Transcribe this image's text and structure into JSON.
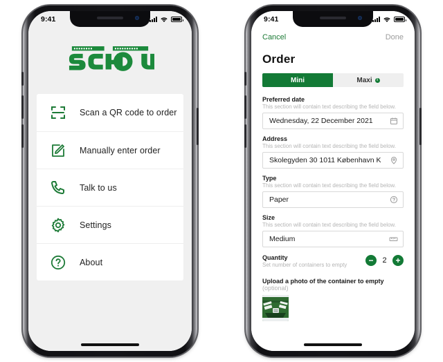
{
  "brand": {
    "accent_green": "#137a36",
    "logo_green": "#1c8a3c",
    "name": "SCHOU",
    "tagline_left": "KØRSEL",
    "tagline_right": "TRANSPORT"
  },
  "status_bar": {
    "time": "9:41",
    "signal_icon": "cellular-bars-icon",
    "wifi_icon": "wifi-icon",
    "battery_icon": "battery-icon"
  },
  "home_screen": {
    "logo_name": "schou-logo",
    "menu": [
      {
        "label": "Scan a QR code to order",
        "icon": "qr-scan-icon",
        "name": "menu-item-scan-qr"
      },
      {
        "label": "Manually enter order",
        "icon": "pencil-square-icon",
        "name": "menu-item-manual-order"
      },
      {
        "label": "Talk to us",
        "icon": "phone-icon",
        "name": "menu-item-talk-to-us"
      },
      {
        "label": "Settings",
        "icon": "gear-icon",
        "name": "menu-item-settings"
      },
      {
        "label": "About",
        "icon": "question-circle-icon",
        "name": "menu-item-about"
      }
    ]
  },
  "order_screen": {
    "nav": {
      "cancel_label": "Cancel",
      "done_label": "Done"
    },
    "title": "Order",
    "segmented": {
      "options": [
        {
          "label": "Mini",
          "selected": true,
          "info_dot": false
        },
        {
          "label": "Maxi",
          "selected": false,
          "info_dot": true,
          "dot_glyph": "i"
        }
      ]
    },
    "help_text": "This section will contain text describing the field below.",
    "fields": [
      {
        "label": "Preferred date",
        "help": "This section will contain text describing the field below.",
        "value": "Wednesday, 22 December 2021",
        "icon": "calendar-icon",
        "name": "preferred-date-field"
      },
      {
        "label": "Address",
        "help": "This section will contain text describing the field below.",
        "value": "Skolegyden 30 1011 København K",
        "icon": "location-pin-icon",
        "name": "address-field"
      },
      {
        "label": "Type",
        "help": "This section will contain text describing the field below.",
        "value": "Paper",
        "icon": "question-circle-icon",
        "name": "type-field"
      },
      {
        "label": "Size",
        "help": "This section will contain text describing the field below.",
        "value": "Medium",
        "icon": "ruler-icon",
        "name": "size-field"
      }
    ],
    "quantity": {
      "label": "Quantity",
      "help": "Set number of containers to empty",
      "value": "2",
      "decrement_label": "−",
      "increment_label": "+"
    },
    "upload": {
      "label": "Upload a photo of the container to empty",
      "optional_label": "(optional)",
      "thumbnail_name": "container-photo-thumbnail"
    }
  }
}
